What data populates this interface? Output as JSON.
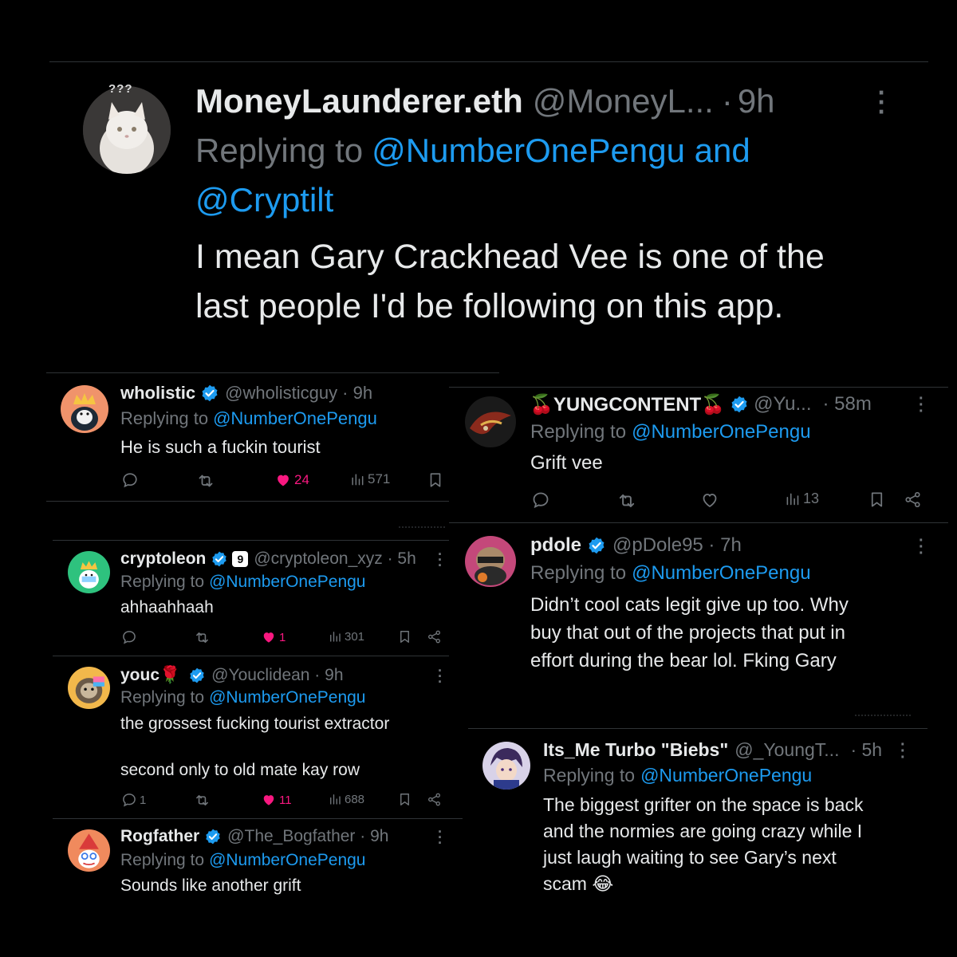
{
  "main": {
    "display_name": "MoneyLaunderer.eth",
    "handle": "@MoneyL...",
    "sep": "·",
    "time": "9h",
    "reply_prefix": "Replying to",
    "reply_to_1": "@NumberOnePengu and",
    "reply_to_2": "@Cryptilt",
    "text_line_1": "I mean Gary Crackhead Vee is one of the",
    "text_line_2": "last people I'd be following on this app.",
    "avatar_tag": "???"
  },
  "left": [
    {
      "display_name": "wholistic",
      "handle": "@wholisticguy · 9h",
      "reply_prefix": "Replying to",
      "reply_to": "@NumberOnePengu",
      "text": [
        "He is such a fuckin tourist"
      ],
      "likes": "24",
      "views": "571"
    },
    {
      "display_name": "cryptoleon",
      "badge": "9",
      "handle": "@cryptoleon_xyz · 5h",
      "reply_prefix": "Replying to",
      "reply_to": "@NumberOnePengu",
      "text": [
        "ahhaahhaah"
      ],
      "likes": "1",
      "views": "301"
    },
    {
      "display_name": "youc🌹",
      "handle": "@Youclidean · 9h",
      "reply_prefix": "Replying to",
      "reply_to": "@NumberOnePengu",
      "text": [
        "the grossest fucking tourist extractor",
        "second only to old mate kay row"
      ],
      "replies": "1",
      "likes": "11",
      "views": "688"
    },
    {
      "display_name": "Rogfather",
      "handle": "@The_Bogfather · 9h",
      "reply_prefix": "Replying to",
      "reply_to": "@NumberOnePengu",
      "text": [
        "Sounds like another grift"
      ]
    }
  ],
  "right": [
    {
      "display_name": "🍒YUNGCONTENT🍒",
      "handle": "@Yu...",
      "time": "· 58m",
      "reply_prefix": "Replying to",
      "reply_to": "@NumberOnePengu",
      "text": [
        "Grift vee"
      ],
      "views": "13"
    },
    {
      "display_name": "pdole",
      "handle": "@pDole95 · 7h",
      "reply_prefix": "Replying to",
      "reply_to": "@NumberOnePengu",
      "text": [
        "Didn’t cool cats legit give up too. Why",
        "buy that out of the projects that put in",
        "effort during the bear lol. Fking Gary"
      ]
    },
    {
      "display_name": "Its_Me Turbo \"Biebs\"",
      "handle": "@_YoungT...",
      "time": "· 5h",
      "reply_prefix": "Replying to",
      "reply_to": "@NumberOnePengu",
      "text": [
        "The biggest grifter on the space is back",
        "and the normies are going crazy while I",
        "just laugh waiting to see Gary’s next",
        "scam 😂"
      ]
    }
  ],
  "colors": {
    "background": "#000000",
    "text": "#e7e9ea",
    "muted": "#71767b",
    "link": "#1d9bf0",
    "like": "#f91880",
    "divider": "#2f3336"
  },
  "icons": [
    "more-icon",
    "reply-icon",
    "retweet-icon",
    "heart-icon",
    "views-icon",
    "bookmark-icon",
    "share-icon",
    "verified-icon"
  ]
}
